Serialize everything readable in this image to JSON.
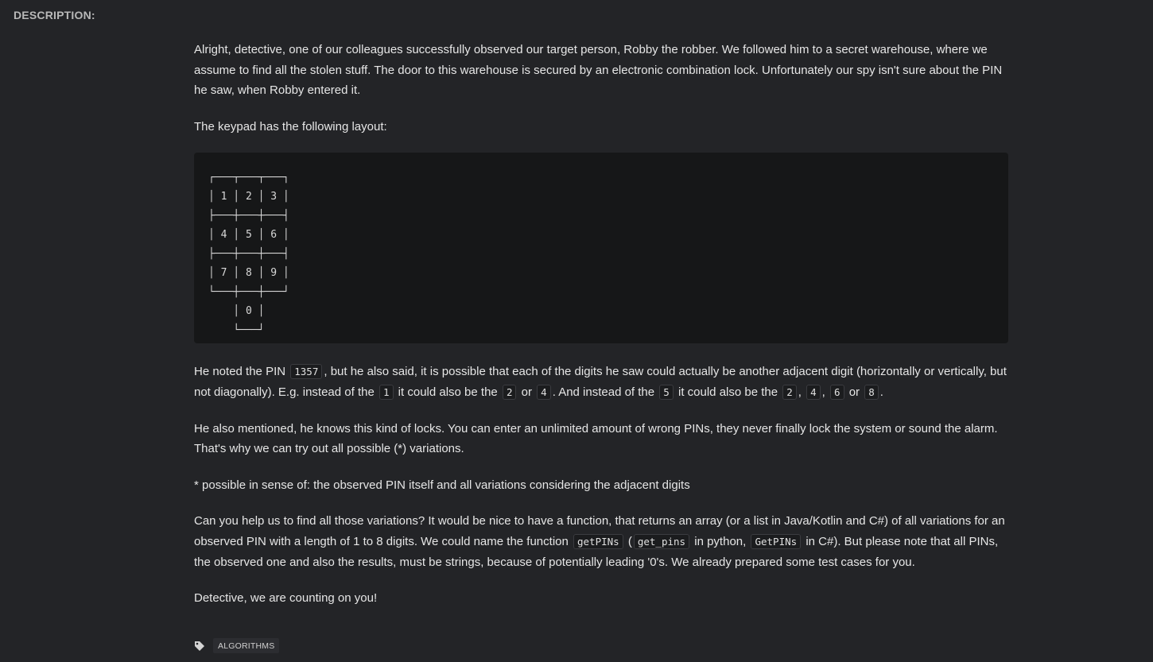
{
  "header": {
    "title": "DESCRIPTION:"
  },
  "description": {
    "intro": "Alright, detective, one of our colleagues successfully observed our target person, Robby the robber. We followed him to a secret warehouse, where we assume to find all the stolen stuff. The door to this warehouse is secured by an electronic combination lock. Unfortunately our spy isn't sure about the PIN he saw, when Robby entered it.",
    "keypad_intro": "The keypad has the following layout:",
    "keypad": "┌───┬───┬───┐\n│ 1 │ 2 │ 3 │\n├───┼───┼───┤\n│ 4 │ 5 │ 6 │\n├───┼───┼───┤\n│ 7 │ 8 │ 9 │\n└───┼───┼───┘\n    │ 0 │\n    └───┘",
    "pin_para": {
      "t1": "He noted the PIN ",
      "c1": "1357",
      "t2": ", but he also said, it is possible that each of the digits he saw could actually be another adjacent digit (horizontally or vertically, but not diagonally). E.g. instead of the ",
      "c2": "1",
      "t3": " it could also be the ",
      "c3": "2",
      "t4": " or ",
      "c4": "4",
      "t5": ". And instead of the ",
      "c5": "5",
      "t6": " it could also be the ",
      "c6": "2",
      "t7": ", ",
      "c7": "4",
      "t8": ", ",
      "c8": "6",
      "t9": " or ",
      "c9": "8",
      "t10": "."
    },
    "locks_para": "He also mentioned, he knows this kind of locks. You can enter an unlimited amount of wrong PINs, they never finally lock the system or sound the alarm. That's why we can try out all possible (*) variations.",
    "footnote": "* possible in sense of: the observed PIN itself and all variations considering the adjacent digits",
    "task_para": {
      "t1": "Can you help us to find all those variations? It would be nice to have a function, that returns an array (or a list in Java/Kotlin and C#) of all variations for an observed PIN with a length of 1 to 8 digits. We could name the function ",
      "c1": "getPINs",
      "t2": " (",
      "c2": "get_pins",
      "t3": " in python, ",
      "c3": "GetPINs",
      "t4": " in C#). But please note that all PINs, the observed one and also the results, must be strings, because of potentially leading '0's. We already prepared some test cases for you."
    },
    "closing": "Detective, we are counting on you!"
  },
  "tags": {
    "icon": "tag-icon",
    "items": [
      "ALGORITHMS"
    ]
  }
}
